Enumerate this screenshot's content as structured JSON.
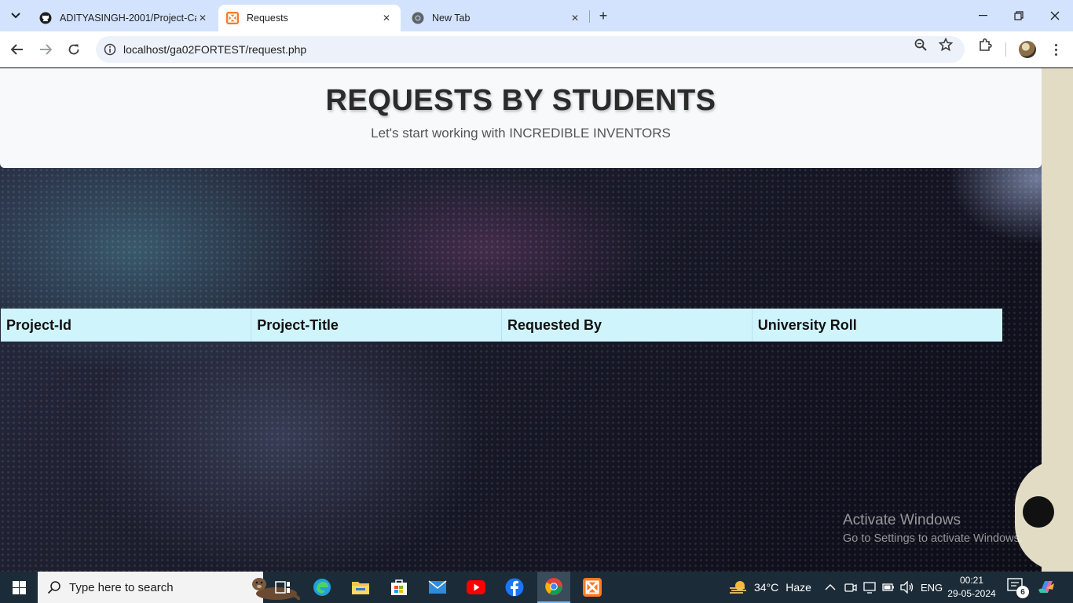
{
  "browser": {
    "tabs": [
      {
        "title": "ADITYASINGH-2001/Project-Ca",
        "favicon": "github-icon",
        "active": false
      },
      {
        "title": "Requests",
        "favicon": "xampp-icon",
        "active": true
      },
      {
        "title": "New Tab",
        "favicon": "chrome-icon",
        "active": false
      }
    ],
    "address": "localhost/ga02FORTEST/request.php"
  },
  "page": {
    "title": "REQUESTS BY STUDENTS",
    "subtitle": "Let's start working with INCREDIBLE INVENTORS",
    "table": {
      "columns": [
        "Project-Id",
        "Project-Title",
        "Requested By",
        "University Roll"
      ],
      "rows": []
    }
  },
  "watermark": {
    "line1": "Activate Windows",
    "line2": "Go to Settings to activate Windows."
  },
  "taskbar": {
    "search_placeholder": "Type here to search",
    "weather": {
      "temp": "34°C",
      "condition": "Haze"
    },
    "language": "ENG",
    "time": "00:21",
    "date": "29-05-2024",
    "notification_count": "6"
  },
  "colors": {
    "tabstrip": "#d3e3fd",
    "table_header_bg": "#cff4fc",
    "header_card_bg": "#f8f9fa",
    "taskbar": "#1c2b38"
  }
}
